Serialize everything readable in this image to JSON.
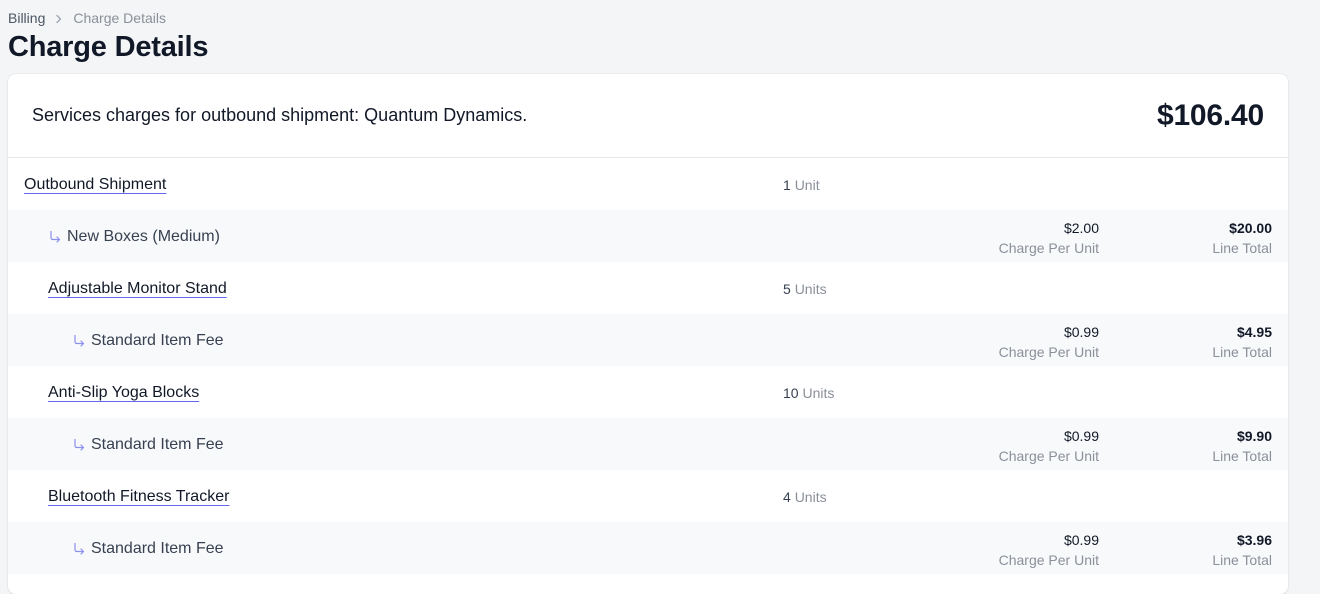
{
  "breadcrumb": {
    "parent": "Billing",
    "current": "Charge Details"
  },
  "page_title": "Charge Details",
  "summary": {
    "description": "Services charges for outbound shipment: Quantum Dynamics.",
    "total": "$106.40"
  },
  "labels": {
    "charge_per_unit": "Charge Per Unit",
    "line_total": "Line Total"
  },
  "rows": [
    {
      "kind": "item",
      "name": "Outbound Shipment",
      "qty": "1",
      "unit": "Unit",
      "indent": 0
    },
    {
      "kind": "fee",
      "name": "New Boxes (Medium)",
      "per_unit": "$2.00",
      "line_total": "$20.00",
      "indent": 0
    },
    {
      "kind": "item",
      "name": "Adjustable Monitor Stand",
      "qty": "5",
      "unit": "Units",
      "indent": 1
    },
    {
      "kind": "fee",
      "name": "Standard Item Fee",
      "per_unit": "$0.99",
      "line_total": "$4.95",
      "indent": 1
    },
    {
      "kind": "item",
      "name": "Anti-Slip Yoga Blocks",
      "qty": "10",
      "unit": "Units",
      "indent": 1
    },
    {
      "kind": "fee",
      "name": "Standard Item Fee",
      "per_unit": "$0.99",
      "line_total": "$9.90",
      "indent": 1
    },
    {
      "kind": "item",
      "name": "Bluetooth Fitness Tracker",
      "qty": "4",
      "unit": "Units",
      "indent": 1
    },
    {
      "kind": "fee",
      "name": "Standard Item Fee",
      "per_unit": "$0.99",
      "line_total": "$3.96",
      "indent": 1
    }
  ]
}
